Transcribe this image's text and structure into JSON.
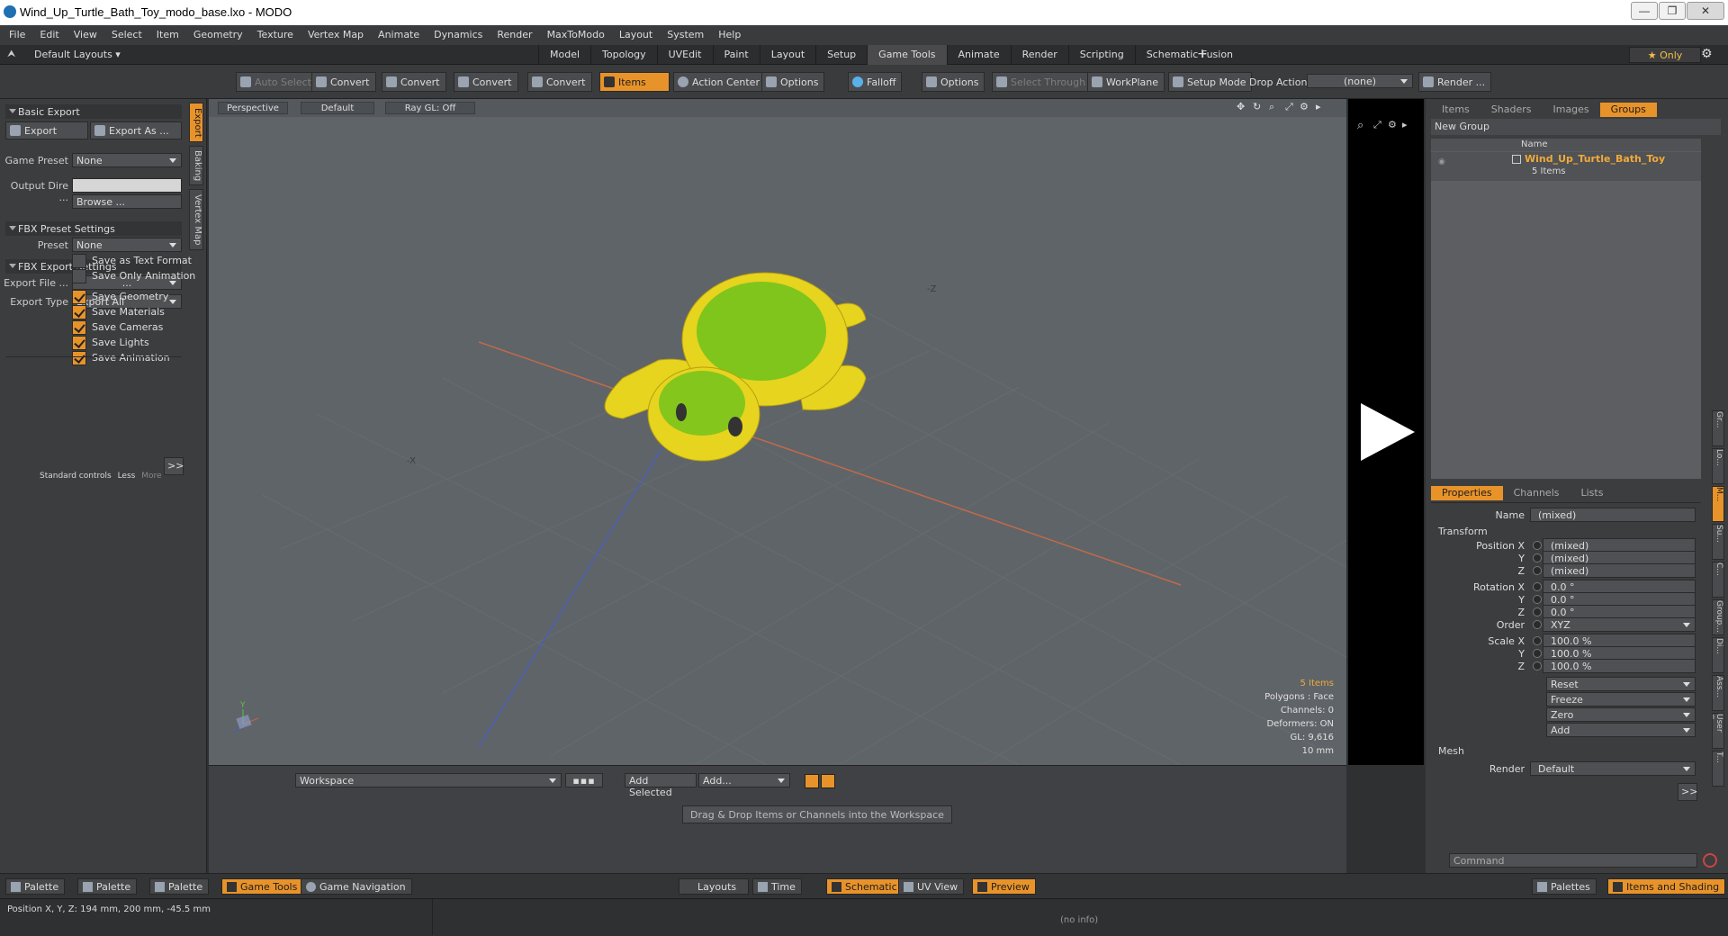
{
  "window": {
    "title": "Wind_Up_Turtle_Bath_Toy_modo_base.lxo - MODO",
    "min": "—",
    "max": "❐",
    "close": "✕"
  },
  "menu": [
    "File",
    "Edit",
    "View",
    "Select",
    "Item",
    "Geometry",
    "Texture",
    "Vertex Map",
    "Animate",
    "Dynamics",
    "Render",
    "MaxToModo",
    "Layout",
    "System",
    "Help"
  ],
  "layouts": {
    "label": "Default Layouts ▾",
    "tabs": [
      "Model",
      "Topology",
      "UVEdit",
      "Paint",
      "Layout",
      "Setup",
      "Game Tools",
      "Animate",
      "Render",
      "Scripting",
      "Schematic Fusion"
    ],
    "active": "Game Tools",
    "add": "+",
    "only": "★ Only"
  },
  "toolbar": {
    "auto_select": "Auto Select",
    "convert": "Convert",
    "items": "Items",
    "action_center": "Action Center",
    "options": "Options",
    "falloff": "Falloff",
    "select_through": "Select Through",
    "workplane": "WorkPlane",
    "setup_mode": "Setup Mode",
    "drop_action": "Drop Action",
    "drop_value": "(none)",
    "render": "Render ..."
  },
  "left": {
    "basic_export": "Basic Export",
    "export": "Export",
    "export_as": "Export As ...",
    "game_preset_label": "Game Preset",
    "game_preset": "None",
    "output_dir_label": "Output Dire ...",
    "browse": "Browse ...",
    "fbx_preset": "FBX Preset Settings",
    "preset_label": "Preset",
    "preset": "None",
    "fbx_export": "FBX Export Settings",
    "export_file_label": "Export File ...",
    "export_file": "...",
    "export_type_label": "Export Type",
    "export_type": "Export All",
    "checks": [
      {
        "label": "Save as Text Format",
        "on": false
      },
      {
        "label": "Save Only Animation",
        "on": false
      },
      {
        "label": "Save Geometry",
        "on": true
      },
      {
        "label": "Save Materials",
        "on": true
      },
      {
        "label": "Save Cameras",
        "on": true
      },
      {
        "label": "Save Lights",
        "on": true
      },
      {
        "label": "Save Animation",
        "on": true
      }
    ],
    "more_btn": ">>",
    "std_controls": "Standard controls",
    "less": "Less",
    "more": "More",
    "vtabs": [
      "Export",
      "Baking",
      "Vertex Map"
    ]
  },
  "viewport": {
    "perspective": "Perspective",
    "default": "Default",
    "raygl": "Ray GL: Off",
    "info": {
      "items": "5 Items",
      "polygons": "Polygons : Face",
      "channels": "Channels: 0",
      "deformers": "Deformers: ON",
      "gl": "GL: 9,616",
      "scale": "10 mm"
    },
    "axis_z": "-Z",
    "axis_x": "-X",
    "gizmo_y": "Y"
  },
  "workspace": {
    "select": "Workspace",
    "add_selected": "Add Selected",
    "add": "Add...",
    "hint": "Drag & Drop Items or Channels into the Workspace"
  },
  "right": {
    "tabs": [
      "Items",
      "Shaders",
      "Images",
      "Groups"
    ],
    "active": "Groups",
    "new_group": "New Group",
    "col_name": "Name",
    "group_name": "Wind_Up_Turtle_Bath_Toy",
    "group_count": "5 Items",
    "prop_tabs": [
      "Properties",
      "Channels",
      "Lists"
    ],
    "prop_active": "Properties",
    "name_label": "Name",
    "name_val": "(mixed)",
    "transform": "Transform",
    "pos_label": "Position X",
    "pos": [
      "(mixed)",
      "(mixed)",
      "(mixed)"
    ],
    "rot_label": "Rotation X",
    "rot": [
      "0.0 °",
      "0.0 °",
      "0.0 °"
    ],
    "order_label": "Order",
    "order": "XYZ",
    "scale_label": "Scale X",
    "scale": [
      "100.0 %",
      "100.0 %",
      "100.0 %"
    ],
    "yl": "Y",
    "zl": "Z",
    "actions": [
      "Reset",
      "Freeze",
      "Zero",
      "Add"
    ],
    "mesh": "Mesh",
    "render_label": "Render",
    "render_val": "Default",
    "more": ">>",
    "command": "Command",
    "side_tabs": [
      "Gr...",
      "Lo...",
      "M...",
      "Su...",
      "C...",
      "Group...",
      "Di...",
      "Ass...",
      "User C...",
      "T..."
    ]
  },
  "bottom": {
    "left": [
      "Palette",
      "Palette",
      "Palette",
      "Game Tools",
      "Game Navigation"
    ],
    "center": [
      "Layouts",
      "Time",
      "Schematic",
      "UV View",
      "Preview"
    ],
    "right": [
      "Palettes",
      "Items and Shading"
    ]
  },
  "status": {
    "pos": "Position X, Y, Z:   194 mm, 200 mm, -45.5 mm",
    "info": "(no info)"
  },
  "colors": {
    "accent": "#e8932a",
    "turtle": "#e6d41f",
    "turtle_green": "#6cc21c"
  }
}
